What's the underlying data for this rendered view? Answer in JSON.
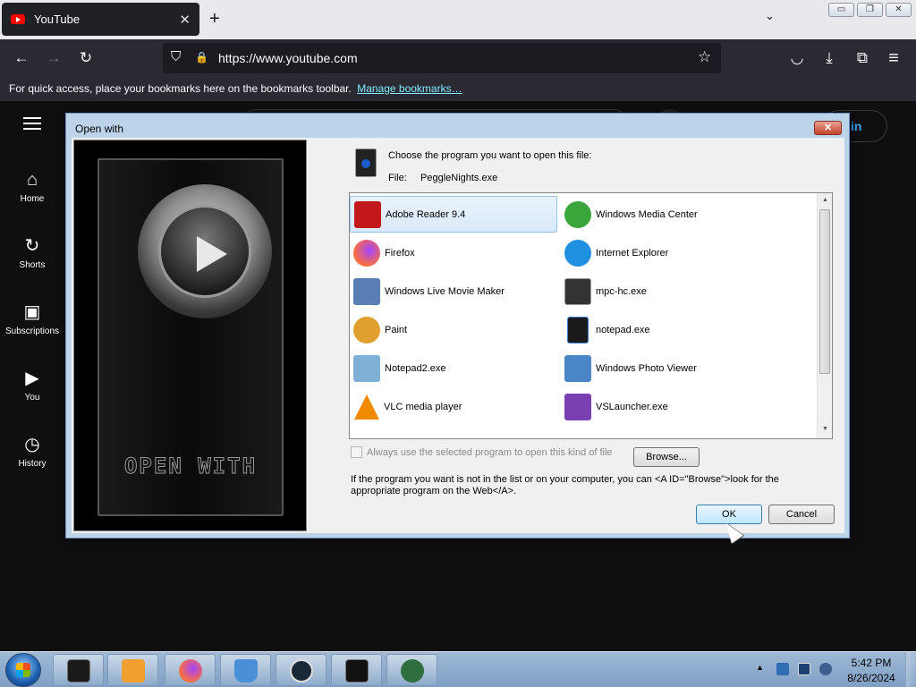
{
  "browser": {
    "tab_title": "YouTube",
    "tab_close": "✕",
    "new_tab": "+",
    "tab_list": "⌄",
    "window_controls": {
      "minimize": "▭",
      "restore": "❐",
      "close": "✕"
    },
    "url": "https://www.youtube.com",
    "bookmarks_text": "For quick access, place your bookmarks here on the bookmarks toolbar.",
    "bookmarks_link": "Manage bookmarks…",
    "icons": {
      "back": "←",
      "forward": "→",
      "reload": "↻",
      "shield": "⛉",
      "lock": "🔒",
      "star": "☆",
      "pocket": "◡",
      "downloads": "⤓",
      "extensions": "⧉",
      "menu": "≡"
    }
  },
  "youtube": {
    "sign_in": "in",
    "nav": [
      {
        "label": "Home",
        "icon": "⌂"
      },
      {
        "label": "Shorts",
        "icon": "↻"
      },
      {
        "label": "Subscriptions",
        "icon": "▣"
      },
      {
        "label": "You",
        "icon": "▶"
      },
      {
        "label": "History",
        "icon": "◷"
      }
    ]
  },
  "dialog": {
    "title": "Open with",
    "close": "✕",
    "banner_text": "OPEN WITH",
    "prompt": "Choose the program you want to open this file:",
    "file_label": "File:",
    "file_name": "PeggleNights.exe",
    "programs": [
      {
        "name": "Adobe Reader 9.4",
        "icon": "adobe-reader-icon",
        "color": "#c2181b",
        "selected": true
      },
      {
        "name": "Windows Media Center",
        "icon": "windows-media-center-icon",
        "color": "#3aa53a"
      },
      {
        "name": "Firefox",
        "icon": "firefox-icon",
        "color": "#ff7139"
      },
      {
        "name": "Internet Explorer",
        "icon": "internet-explorer-icon",
        "color": "#1f8fe0"
      },
      {
        "name": "Windows Live Movie Maker",
        "icon": "movie-maker-icon",
        "color": "#5a7fb5"
      },
      {
        "name": "mpc-hc.exe",
        "icon": "mpc-hc-icon",
        "color": "#333333"
      },
      {
        "name": "Paint",
        "icon": "paint-icon",
        "color": "#e0a030"
      },
      {
        "name": "notepad.exe",
        "icon": "notepad-icon",
        "color": "#1a1a1a"
      },
      {
        "name": "Notepad2.exe",
        "icon": "notepad2-icon",
        "color": "#7fb0d8"
      },
      {
        "name": "Windows Photo Viewer",
        "icon": "photo-viewer-icon",
        "color": "#4a86c5"
      },
      {
        "name": "VLC media player",
        "icon": "vlc-icon",
        "color": "#f08a00"
      },
      {
        "name": "VSLauncher.exe",
        "icon": "vslauncher-icon",
        "color": "#7a3fb0"
      }
    ],
    "always_label": "Always use the selected program to open this kind of file",
    "browse_label": "Browse...",
    "info_text": "If the program you want is not in the list or on your computer, you can <A ID=\"Browse\">look for the appropriate program on the Web</A>.",
    "ok_label": "OK",
    "cancel_label": "Cancel"
  },
  "taskbar": {
    "items": [
      {
        "icon": "black-box-icon",
        "color": "#1a1a1a"
      },
      {
        "icon": "media-player-icon",
        "color": "#f0a030"
      },
      {
        "icon": "firefox-icon",
        "color": "#ff7139"
      },
      {
        "icon": "recycle-bin-icon",
        "color": "#4a90d9"
      },
      {
        "icon": "steam-icon",
        "color": "#1b2838"
      },
      {
        "icon": "terminal-icon",
        "color": "#111111"
      },
      {
        "icon": "game-app-icon",
        "color": "#2f6f3f"
      }
    ],
    "tray_arrow": "▲",
    "time": "5:42 PM",
    "date": "8/26/2024"
  }
}
